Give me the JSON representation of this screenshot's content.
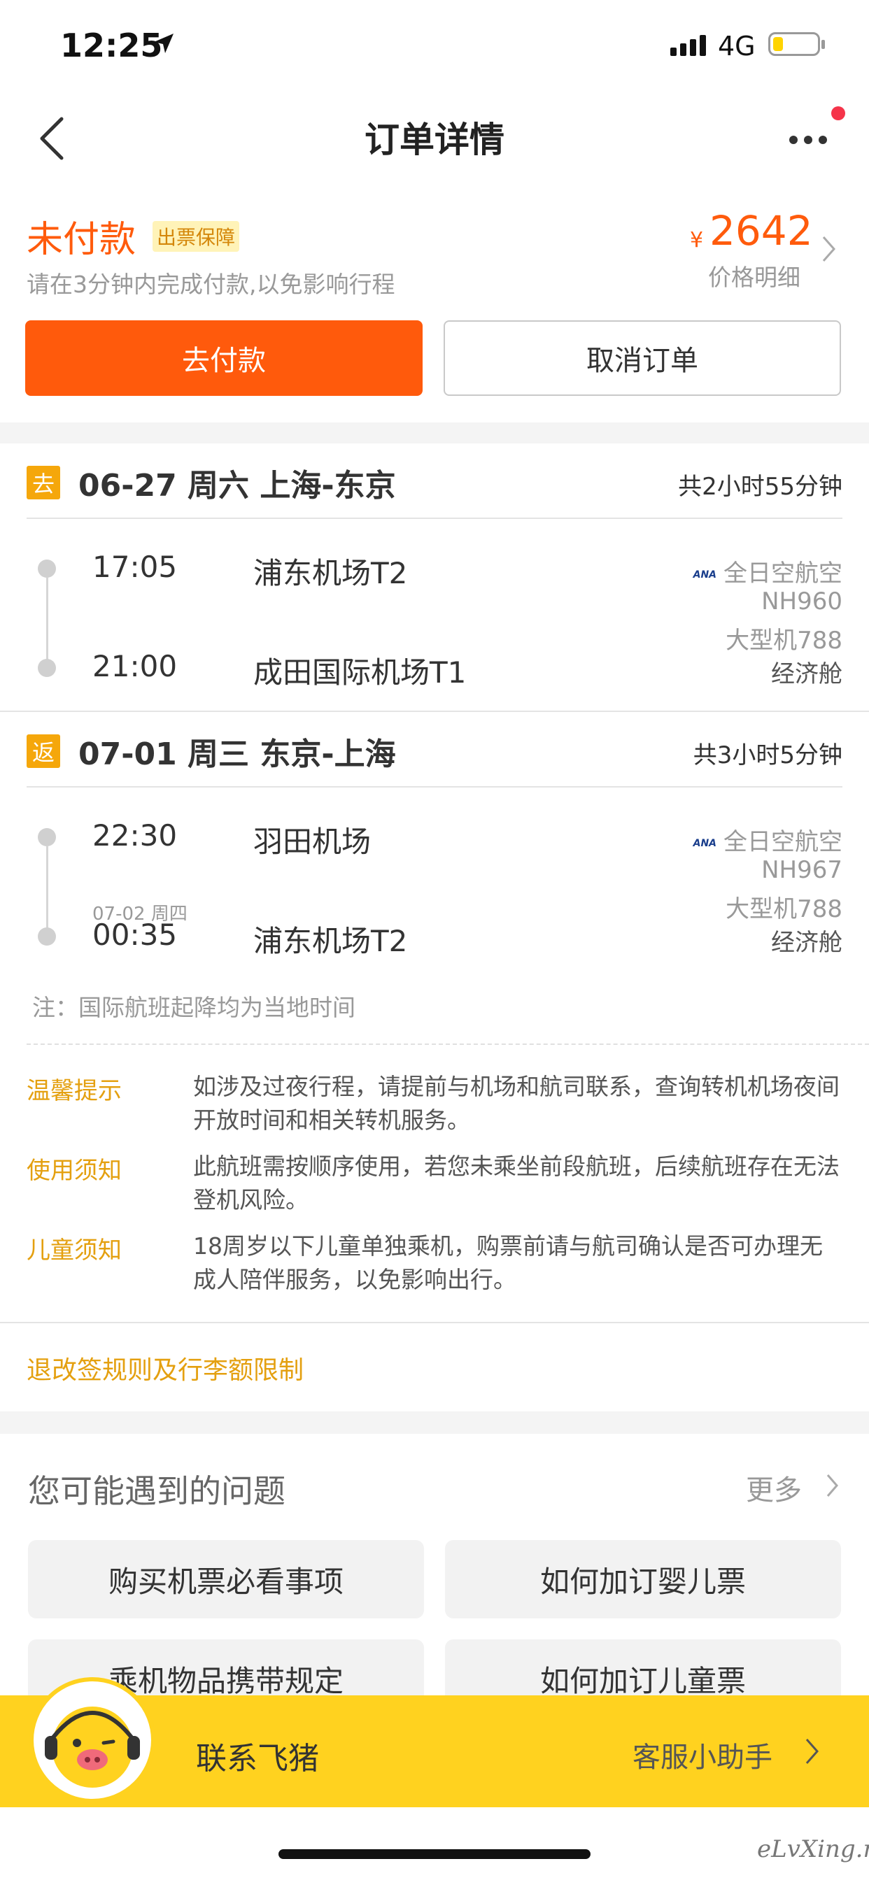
{
  "status_bar": {
    "time": "12:25",
    "network": "4G"
  },
  "nav": {
    "title": "订单详情"
  },
  "order": {
    "status": "未付款",
    "badge": "出票保障",
    "hint": "请在3分钟内完成付款,以免影响行程",
    "currency": "¥",
    "price": "2642",
    "price_detail": "价格明细",
    "pay_label": "去付款",
    "cancel_label": "取消订单"
  },
  "outbound": {
    "tag": "去",
    "title": "06-27 周六 上海-东京",
    "duration": "共2小时55分钟",
    "dep_time": "17:05",
    "dep_airport": "浦东机场T2",
    "arr_time": "21:00",
    "arr_airport": "成田国际机场T1",
    "airline": "全日空航空",
    "flight_no": "NH960",
    "aircraft": "大型机788",
    "cabin": "经济舱"
  },
  "return": {
    "tag": "返",
    "title": "07-01 周三 东京-上海",
    "duration": "共3小时5分钟",
    "dep_time": "22:30",
    "dep_airport": "羽田机场",
    "arr_date": "07-02 周四",
    "arr_time": "00:35",
    "arr_airport": "浦东机场T2",
    "airline": "全日空航空",
    "flight_no": "NH967",
    "aircraft": "大型机788",
    "cabin": "经济舱"
  },
  "airline_logo_text": "ANA",
  "note": "注：国际航班起降均为当地时间",
  "tips": [
    {
      "label": "温馨提示",
      "text": "如涉及过夜行程，请提前与机场和航司联系，查询转机机场夜间开放时间和相关转机服务。"
    },
    {
      "label": "使用须知",
      "text": "此航班需按顺序使用，若您未乘坐前段航班，后续航班存在无法登机风险。"
    },
    {
      "label": "儿童须知",
      "text": "18周岁以下儿童单独乘机，购票前请与航司确认是否可办理无成人陪伴服务，以免影响出行。"
    }
  ],
  "rules_link": "退改签规则及行李额限制",
  "faq": {
    "title": "您可能遇到的问题",
    "more": "更多",
    "items": [
      "购买机票必看事项",
      "如何加订婴儿票",
      "乘机物品携带规定",
      "如何加订儿童票"
    ]
  },
  "contact": {
    "label": "联系飞猪",
    "assistant": "客服小助手"
  },
  "watermark": "eLvXing.net",
  "colors": {
    "accent": "#ff5a0c",
    "gold": "#e4a010",
    "contact_bar": "#ffd21f"
  }
}
